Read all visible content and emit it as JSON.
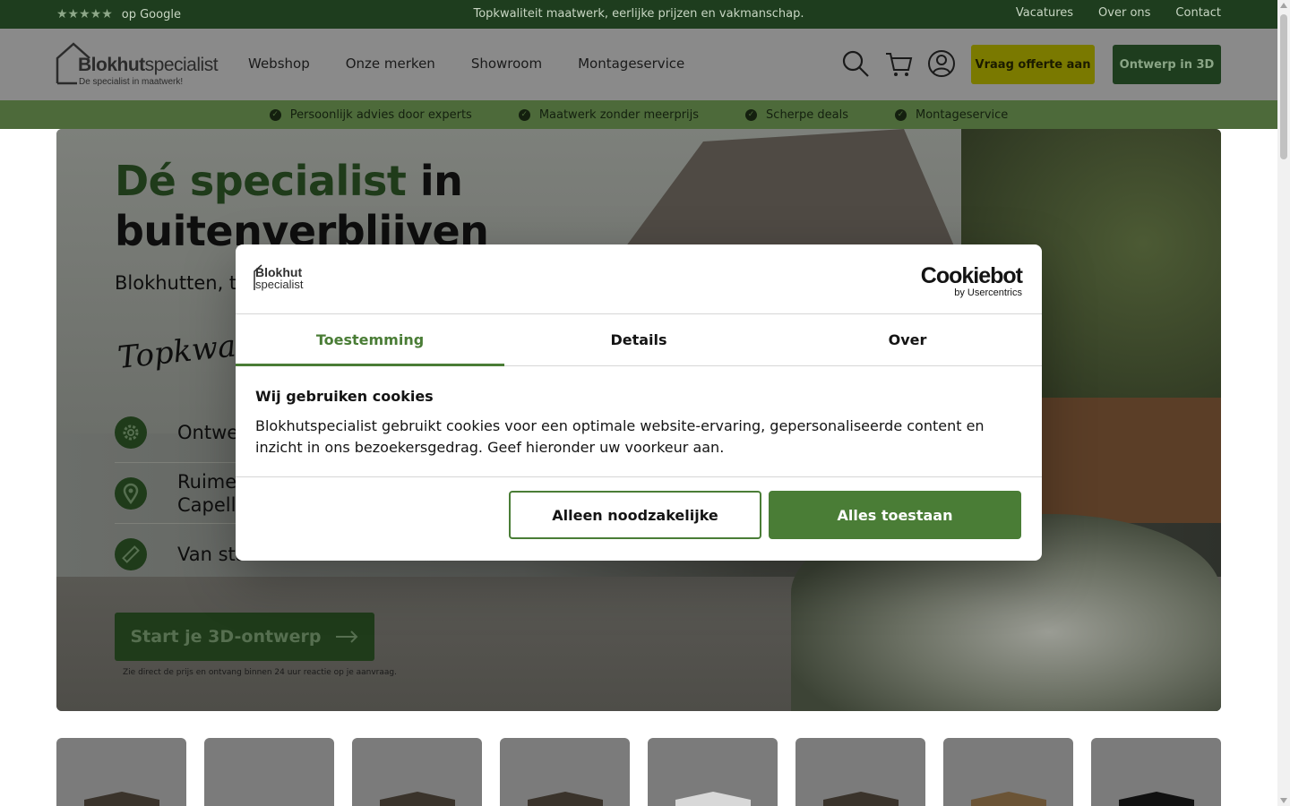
{
  "topbar": {
    "rating_stars": "★★★★★",
    "rating_text": "op Google",
    "tagline": "Topkwaliteit maatwerk, eerlijke prijzen en vakmanschap.",
    "links": [
      "Vacatures",
      "Over ons",
      "Contact"
    ]
  },
  "header": {
    "logo_name_bold": "Blokhut",
    "logo_name_rest": "specialist",
    "logo_sub": "De specialist in maatwerk!",
    "nav": [
      "Webshop",
      "Onze merken",
      "Showroom",
      "Montageservice"
    ],
    "icons": [
      "search-icon",
      "cart-icon",
      "account-icon"
    ],
    "quote_button": "Vraag offerte aan",
    "design_button": "Ontwerp in 3D"
  },
  "usp": [
    "Persoonlijk advies door experts",
    "Maatwerk zonder meerprijs",
    "Scherpe deals",
    "Montageservice"
  ],
  "hero": {
    "title_accent": "Dé specialist",
    "title_rest_1": " in",
    "title_line_2": "buitenverblijven",
    "subtitle": "Blokhutten, tu",
    "script": "Topkwaliteit",
    "features": [
      {
        "icon": "gear-icon",
        "text": "Ontwe"
      },
      {
        "icon": "location-pin-icon",
        "text": "Ruime\nCapelle"
      },
      {
        "icon": "ruler-icon",
        "text": "Van sta"
      }
    ],
    "cta": "Start je 3D-ontwerp",
    "cta_note": "Zie direct de prijs en ontvang binnen 24 uur reactie op je aanvraag."
  },
  "cookie_modal": {
    "logo_line1": "Blokhut",
    "logo_line2": "specialist",
    "brand": "Cookiebot",
    "brand_by": "by Usercentrics",
    "tabs": [
      "Toestemming",
      "Details",
      "Over"
    ],
    "active_tab": "Toestemming",
    "heading": "Wij gebruiken cookies",
    "body": "Blokhutspecialist gebruikt cookies voor een optimale website-ervaring, gepersonaliseerde content en inzicht in ons bezoekersgedrag. Geef hieronder uw voorkeur aan.",
    "btn_necessary": "Alleen noodzakelijke",
    "btn_all": "Alles toestaan"
  },
  "colors": {
    "brand_dark_green": "#1e3d1e",
    "cookie_green": "#4a7d36",
    "quote_yellow": "#7a7900"
  }
}
